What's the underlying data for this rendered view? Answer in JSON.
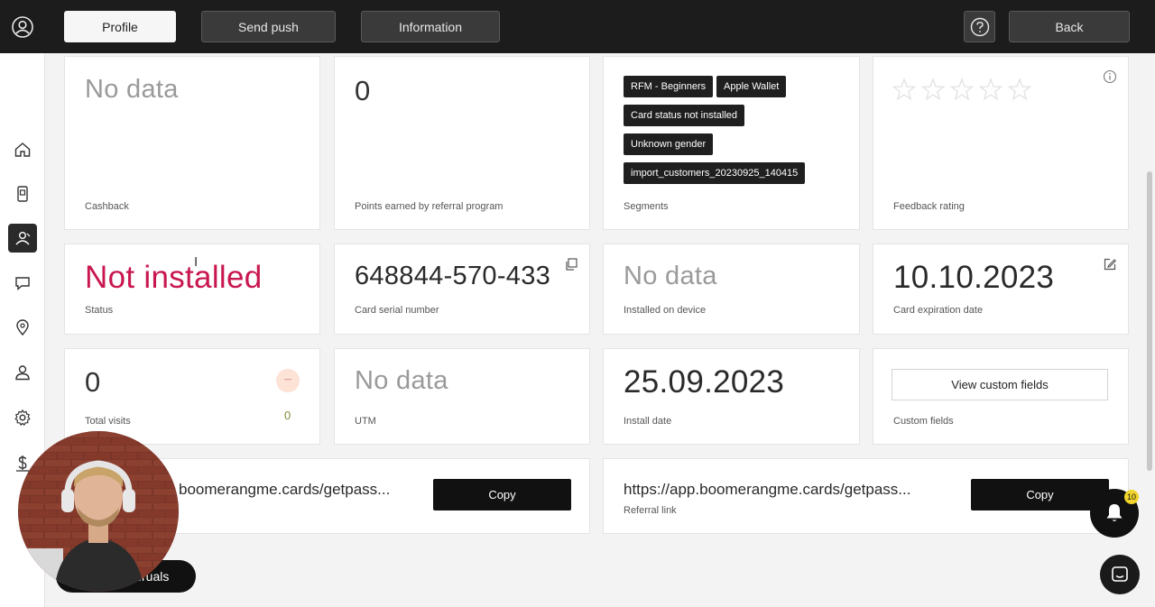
{
  "toolbar": {
    "profile_label": "Profile",
    "send_push_label": "Send push",
    "information_label": "Information",
    "back_label": "Back"
  },
  "sidebar": {
    "icons": [
      "user-circle-icon",
      "home-icon",
      "card-device-icon",
      "customers-icon",
      "chat-icon",
      "location-icon",
      "person-icon",
      "gear-icon",
      "dollar-icon"
    ],
    "active": "customers-icon"
  },
  "cards": {
    "cashback": {
      "value": "No data",
      "label": "Cashback"
    },
    "referral_points": {
      "value": "0",
      "label": "Points earned by referral program"
    },
    "segments": {
      "tags": [
        "RFM - Beginners",
        "Apple Wallet",
        "Card status not installed",
        "Unknown gender",
        "import_customers_20230925_140415"
      ],
      "label": "Segments"
    },
    "feedback": {
      "rating": 0,
      "max": 5,
      "label": "Feedback rating"
    },
    "status": {
      "value": "Not installed",
      "label": "Status"
    },
    "serial": {
      "value": "648844-570-433",
      "label": "Card serial number"
    },
    "device": {
      "value": "No data",
      "label": "Installed on device"
    },
    "expiration": {
      "value": "10.10.2023",
      "label": "Card expiration date"
    },
    "visits": {
      "value": "0",
      "secondary": "0",
      "label": "Total visits"
    },
    "utm": {
      "value": "No data",
      "label": "UTM"
    },
    "install_date": {
      "value": "25.09.2023",
      "label": "Install date"
    },
    "custom_fields": {
      "button": "View custom fields",
      "label": "Custom fields"
    }
  },
  "links": {
    "card_link": {
      "text": "boomerangme.cards/getpass...",
      "button": "Copy"
    },
    "referral_link": {
      "text": "https://app.boomerangme.cards/getpass...",
      "label": "Referral link",
      "button": "Copy"
    }
  },
  "overlay": {
    "accruals_label": "cruals",
    "accruals_tail": "s",
    "notification_count": "10"
  },
  "colors": {
    "status_red": "#c8174f",
    "topbar": "#1c1c1c",
    "notification_badge": "#f1d42b"
  }
}
